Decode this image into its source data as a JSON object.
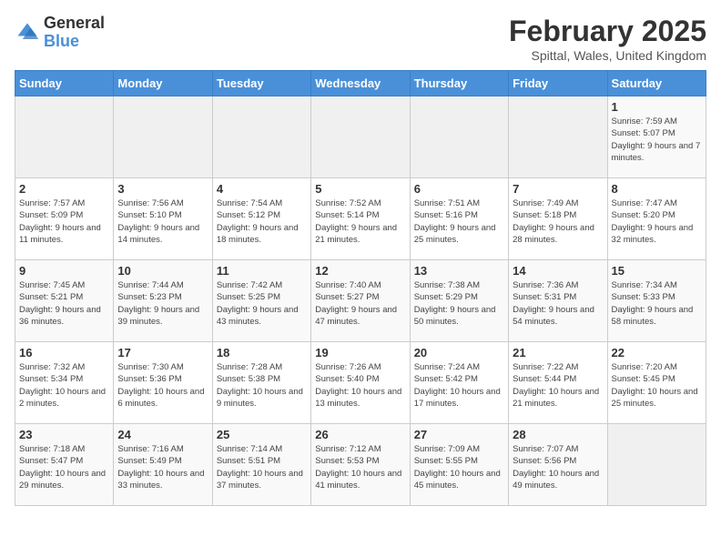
{
  "logo": {
    "general": "General",
    "blue": "Blue"
  },
  "title": "February 2025",
  "subtitle": "Spittal, Wales, United Kingdom",
  "weekdays": [
    "Sunday",
    "Monday",
    "Tuesday",
    "Wednesday",
    "Thursday",
    "Friday",
    "Saturday"
  ],
  "weeks": [
    [
      {
        "day": "",
        "info": ""
      },
      {
        "day": "",
        "info": ""
      },
      {
        "day": "",
        "info": ""
      },
      {
        "day": "",
        "info": ""
      },
      {
        "day": "",
        "info": ""
      },
      {
        "day": "",
        "info": ""
      },
      {
        "day": "1",
        "info": "Sunrise: 7:59 AM\nSunset: 5:07 PM\nDaylight: 9 hours and 7 minutes."
      }
    ],
    [
      {
        "day": "2",
        "info": "Sunrise: 7:57 AM\nSunset: 5:09 PM\nDaylight: 9 hours and 11 minutes."
      },
      {
        "day": "3",
        "info": "Sunrise: 7:56 AM\nSunset: 5:10 PM\nDaylight: 9 hours and 14 minutes."
      },
      {
        "day": "4",
        "info": "Sunrise: 7:54 AM\nSunset: 5:12 PM\nDaylight: 9 hours and 18 minutes."
      },
      {
        "day": "5",
        "info": "Sunrise: 7:52 AM\nSunset: 5:14 PM\nDaylight: 9 hours and 21 minutes."
      },
      {
        "day": "6",
        "info": "Sunrise: 7:51 AM\nSunset: 5:16 PM\nDaylight: 9 hours and 25 minutes."
      },
      {
        "day": "7",
        "info": "Sunrise: 7:49 AM\nSunset: 5:18 PM\nDaylight: 9 hours and 28 minutes."
      },
      {
        "day": "8",
        "info": "Sunrise: 7:47 AM\nSunset: 5:20 PM\nDaylight: 9 hours and 32 minutes."
      }
    ],
    [
      {
        "day": "9",
        "info": "Sunrise: 7:45 AM\nSunset: 5:21 PM\nDaylight: 9 hours and 36 minutes."
      },
      {
        "day": "10",
        "info": "Sunrise: 7:44 AM\nSunset: 5:23 PM\nDaylight: 9 hours and 39 minutes."
      },
      {
        "day": "11",
        "info": "Sunrise: 7:42 AM\nSunset: 5:25 PM\nDaylight: 9 hours and 43 minutes."
      },
      {
        "day": "12",
        "info": "Sunrise: 7:40 AM\nSunset: 5:27 PM\nDaylight: 9 hours and 47 minutes."
      },
      {
        "day": "13",
        "info": "Sunrise: 7:38 AM\nSunset: 5:29 PM\nDaylight: 9 hours and 50 minutes."
      },
      {
        "day": "14",
        "info": "Sunrise: 7:36 AM\nSunset: 5:31 PM\nDaylight: 9 hours and 54 minutes."
      },
      {
        "day": "15",
        "info": "Sunrise: 7:34 AM\nSunset: 5:33 PM\nDaylight: 9 hours and 58 minutes."
      }
    ],
    [
      {
        "day": "16",
        "info": "Sunrise: 7:32 AM\nSunset: 5:34 PM\nDaylight: 10 hours and 2 minutes."
      },
      {
        "day": "17",
        "info": "Sunrise: 7:30 AM\nSunset: 5:36 PM\nDaylight: 10 hours and 6 minutes."
      },
      {
        "day": "18",
        "info": "Sunrise: 7:28 AM\nSunset: 5:38 PM\nDaylight: 10 hours and 9 minutes."
      },
      {
        "day": "19",
        "info": "Sunrise: 7:26 AM\nSunset: 5:40 PM\nDaylight: 10 hours and 13 minutes."
      },
      {
        "day": "20",
        "info": "Sunrise: 7:24 AM\nSunset: 5:42 PM\nDaylight: 10 hours and 17 minutes."
      },
      {
        "day": "21",
        "info": "Sunrise: 7:22 AM\nSunset: 5:44 PM\nDaylight: 10 hours and 21 minutes."
      },
      {
        "day": "22",
        "info": "Sunrise: 7:20 AM\nSunset: 5:45 PM\nDaylight: 10 hours and 25 minutes."
      }
    ],
    [
      {
        "day": "23",
        "info": "Sunrise: 7:18 AM\nSunset: 5:47 PM\nDaylight: 10 hours and 29 minutes."
      },
      {
        "day": "24",
        "info": "Sunrise: 7:16 AM\nSunset: 5:49 PM\nDaylight: 10 hours and 33 minutes."
      },
      {
        "day": "25",
        "info": "Sunrise: 7:14 AM\nSunset: 5:51 PM\nDaylight: 10 hours and 37 minutes."
      },
      {
        "day": "26",
        "info": "Sunrise: 7:12 AM\nSunset: 5:53 PM\nDaylight: 10 hours and 41 minutes."
      },
      {
        "day": "27",
        "info": "Sunrise: 7:09 AM\nSunset: 5:55 PM\nDaylight: 10 hours and 45 minutes."
      },
      {
        "day": "28",
        "info": "Sunrise: 7:07 AM\nSunset: 5:56 PM\nDaylight: 10 hours and 49 minutes."
      },
      {
        "day": "",
        "info": ""
      }
    ]
  ]
}
